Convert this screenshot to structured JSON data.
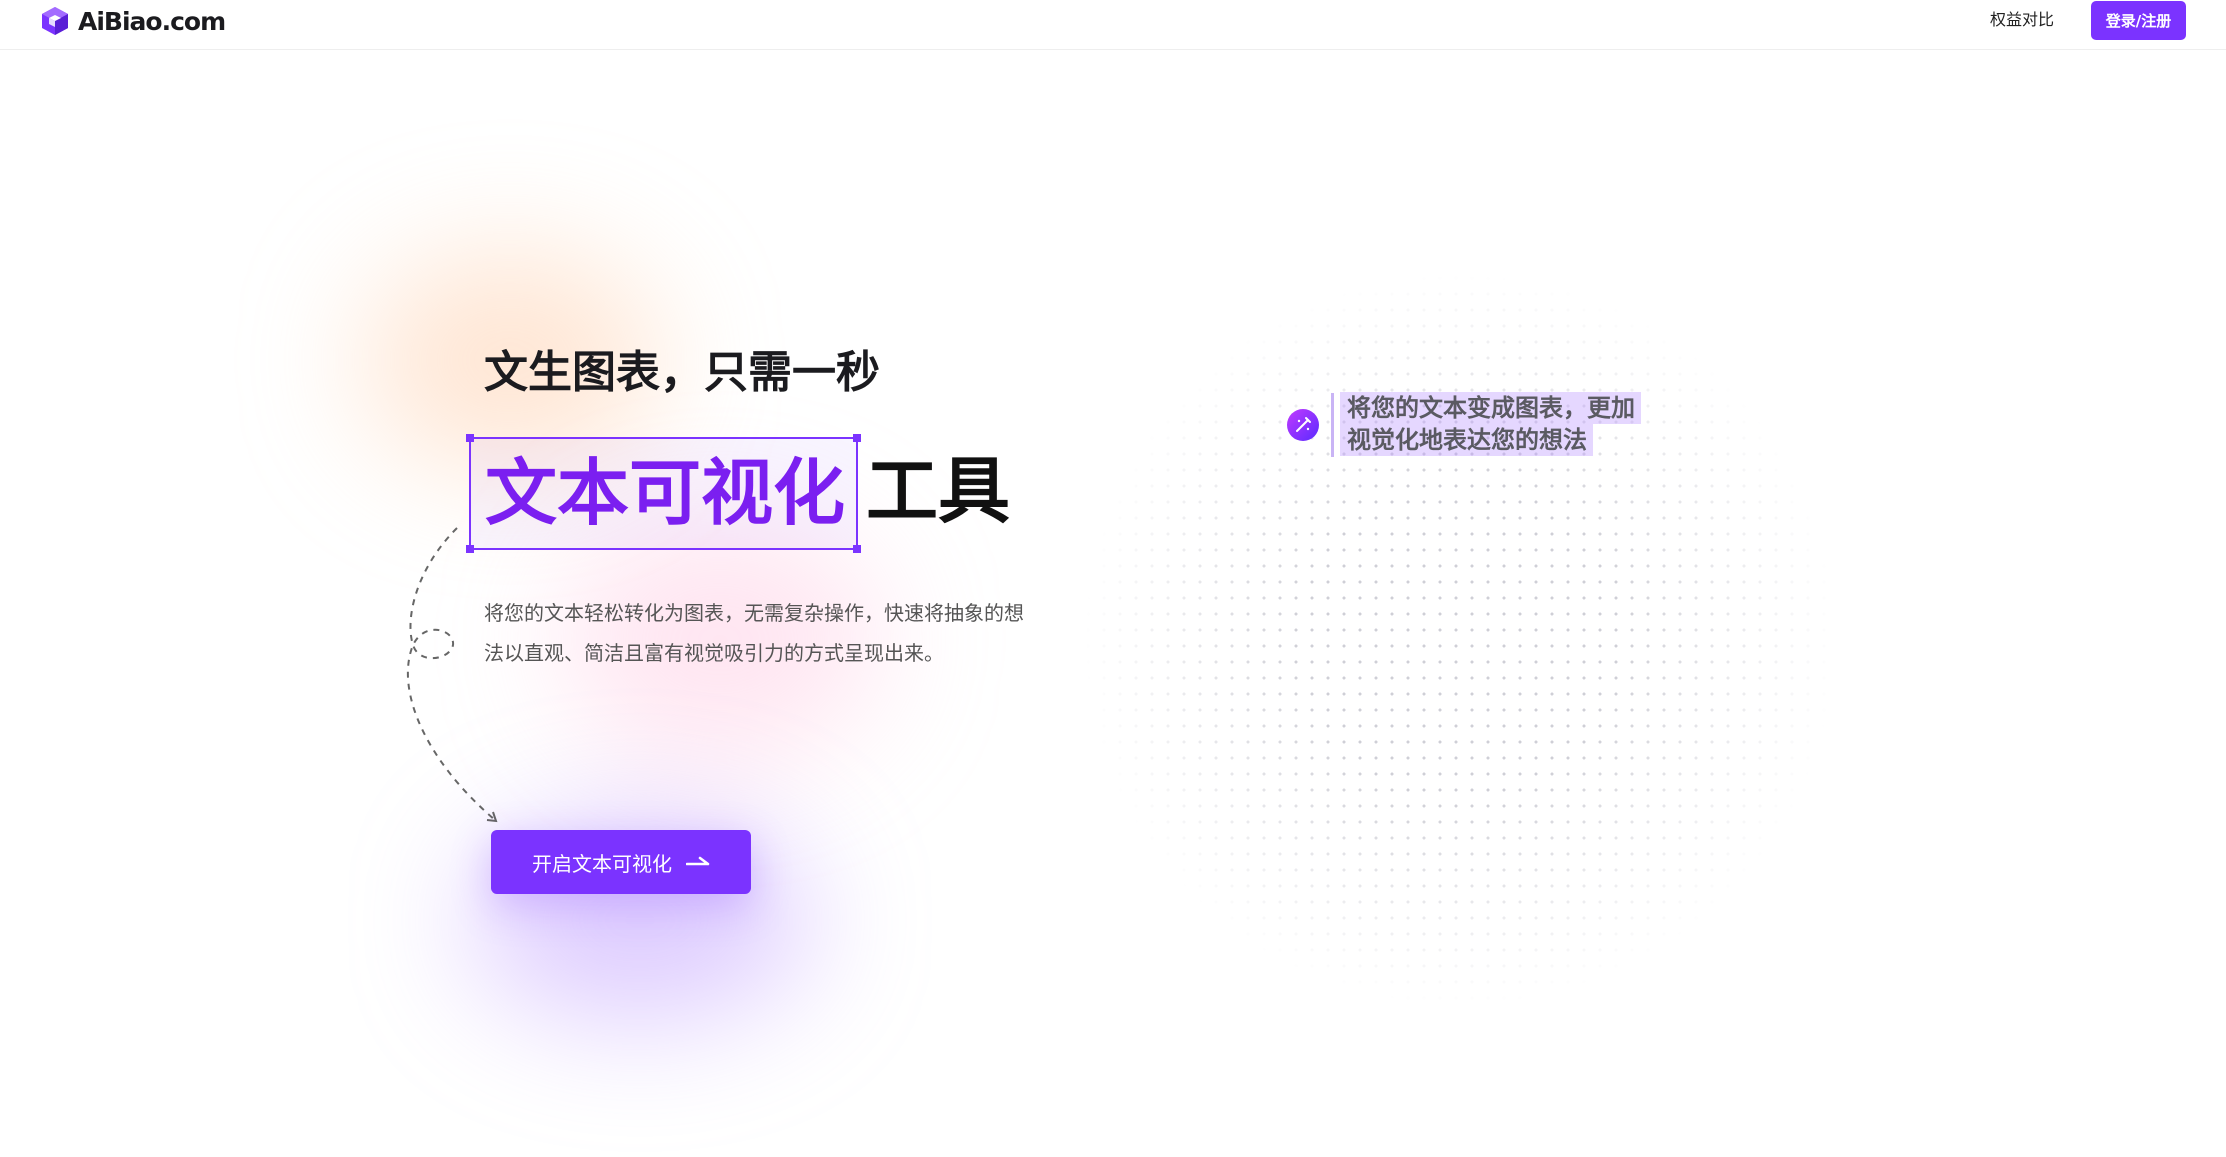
{
  "header": {
    "logo_text": "AiBiao.com",
    "nav_compare": "权益对比",
    "login_label": "登录/注册"
  },
  "hero": {
    "subtitle": "文生图表，只需一秒",
    "highlight": "文本可视化",
    "title_tail": "工具",
    "description": "将您的文本轻松转化为图表，无需复杂操作，快速将抽象的想法以直观、简洁且富有视觉吸引力的方式呈现出来。",
    "cta_label": "开启文本可视化"
  },
  "preview": {
    "icon": "magic-wand-icon",
    "line1": "将您的文本变成图表，更加",
    "line2": "视觉化地表达您的想法"
  },
  "colors": {
    "brand": "#7b33ff",
    "highlight_text": "#7b1ff0"
  }
}
